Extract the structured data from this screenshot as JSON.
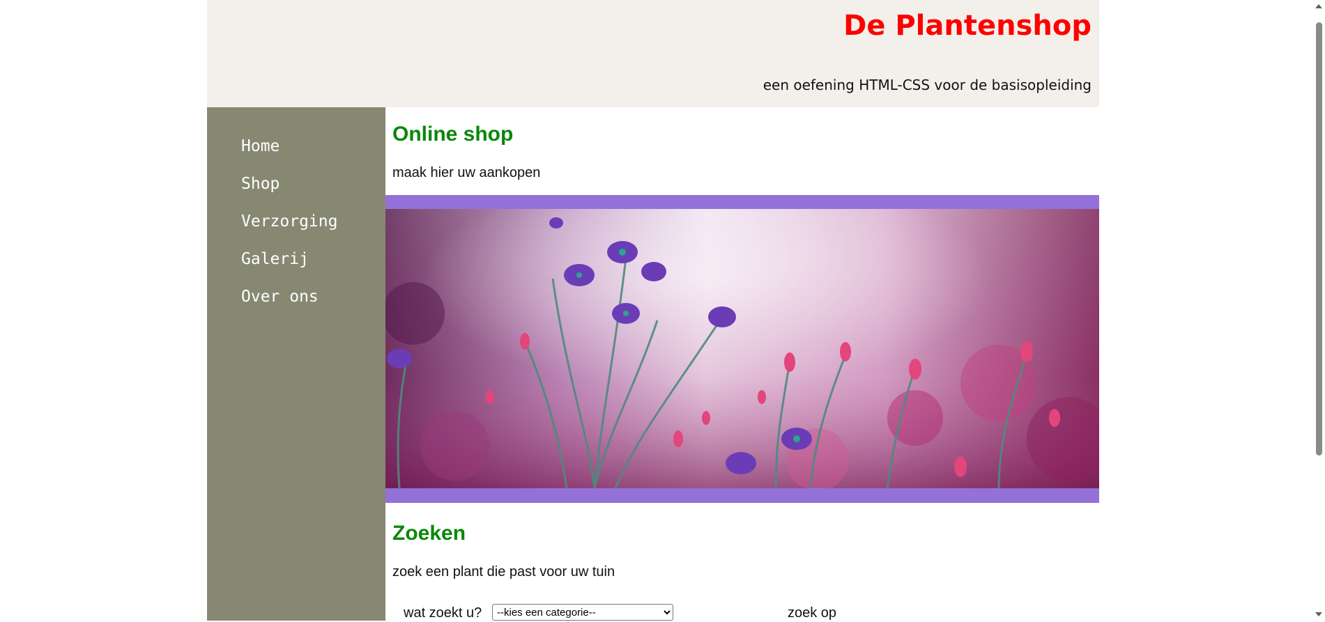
{
  "header": {
    "title": "De Plantenshop",
    "subtitle": "een oefening HTML-CSS voor de basisopleiding"
  },
  "nav": {
    "items": [
      "Home",
      "Shop",
      "Verzorging",
      "Galerij",
      "Over ons"
    ]
  },
  "shop": {
    "heading": "Online shop",
    "intro": "maak hier uw aankopen"
  },
  "search": {
    "heading": "Zoeken",
    "intro": "zoek een plant die past voor uw tuin",
    "label": "wat zoekt u?",
    "select_value": "--kies een categorie--",
    "search_by_label": "zoek op"
  },
  "colors": {
    "title": "#ff0000",
    "heading": "#0a870a",
    "sidebar": "#878871",
    "header_bg": "#f3f0eb",
    "banner_frame": "#9471d8"
  },
  "icons": {
    "banner": "purple-flowers-photo"
  }
}
